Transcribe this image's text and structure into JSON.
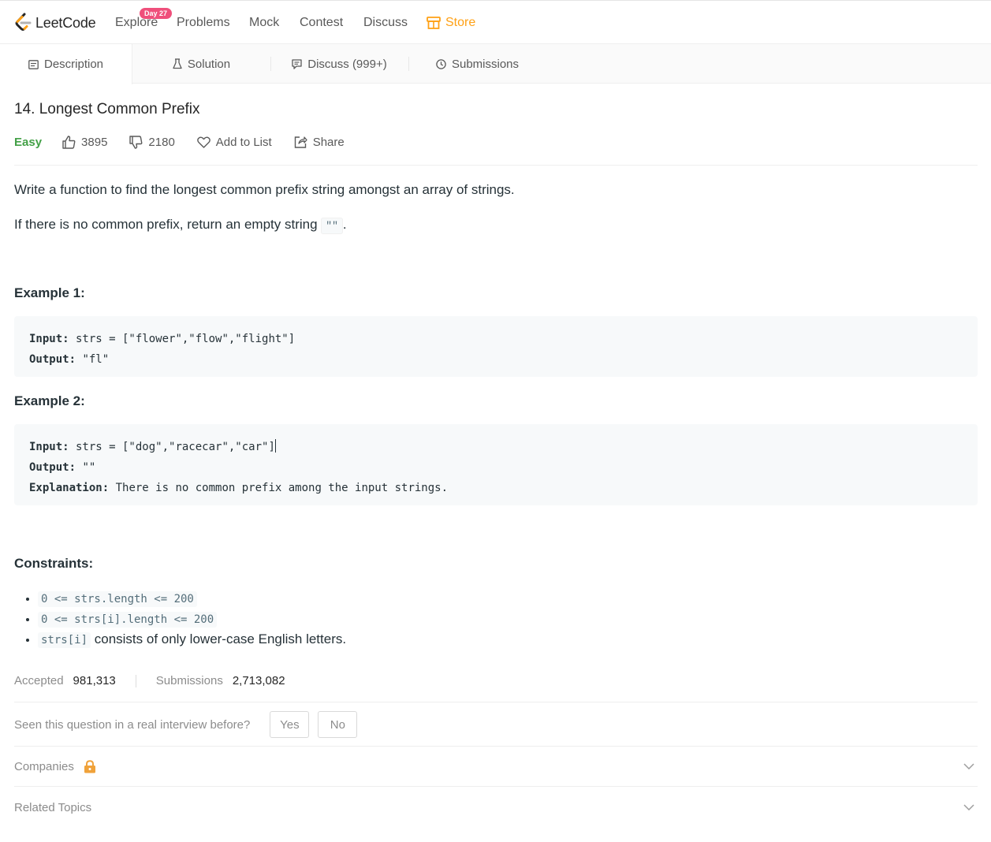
{
  "nav": {
    "brand": "LeetCode",
    "badge": "Day 27",
    "items": [
      "Explore",
      "Problems",
      "Mock",
      "Contest",
      "Discuss"
    ],
    "store": "Store",
    "accent_color": "#ffa116",
    "badge_color": "#ef4f7b"
  },
  "tabs": [
    "Description",
    "Solution",
    "Discuss (999+)",
    "Submissions"
  ],
  "problem": {
    "title": "14. Longest Common Prefix",
    "difficulty": "Easy",
    "likes": "3895",
    "dislikes": "2180",
    "add_to_list": "Add to List",
    "share": "Share",
    "desc1": "Write a function to find the longest common prefix string amongst an array of strings.",
    "desc2_pre": "If there is no common prefix, return an empty string ",
    "desc2_code": "\"\"",
    "desc2_post": "."
  },
  "examples": [
    {
      "heading": "Example 1:",
      "input_label": "Input:",
      "input": " strs = [\"flower\",\"flow\",\"flight\"]",
      "output_label": "Output:",
      "output": " \"fl\""
    },
    {
      "heading": "Example 2:",
      "input_label": "Input:",
      "input": " strs = [\"dog\",\"racecar\",\"car\"]",
      "output_label": "Output:",
      "output": " \"\"",
      "explanation_label": "Explanation:",
      "explanation": " There is no common prefix among the input strings."
    }
  ],
  "constraints": {
    "heading": "Constraints:",
    "c1": "0 <= strs.length <= 200",
    "c2": "0 <= strs[i].length <= 200",
    "c3_code": "strs[i]",
    "c3_text": " consists of only lower-case English letters."
  },
  "stats": {
    "accepted_label": "Accepted",
    "accepted": "981,313",
    "submissions_label": "Submissions",
    "submissions": "2,713,082"
  },
  "interview": {
    "question": "Seen this question in a real interview before?",
    "yes": "Yes",
    "no": "No"
  },
  "sections": {
    "companies": "Companies",
    "related_topics": "Related Topics"
  }
}
